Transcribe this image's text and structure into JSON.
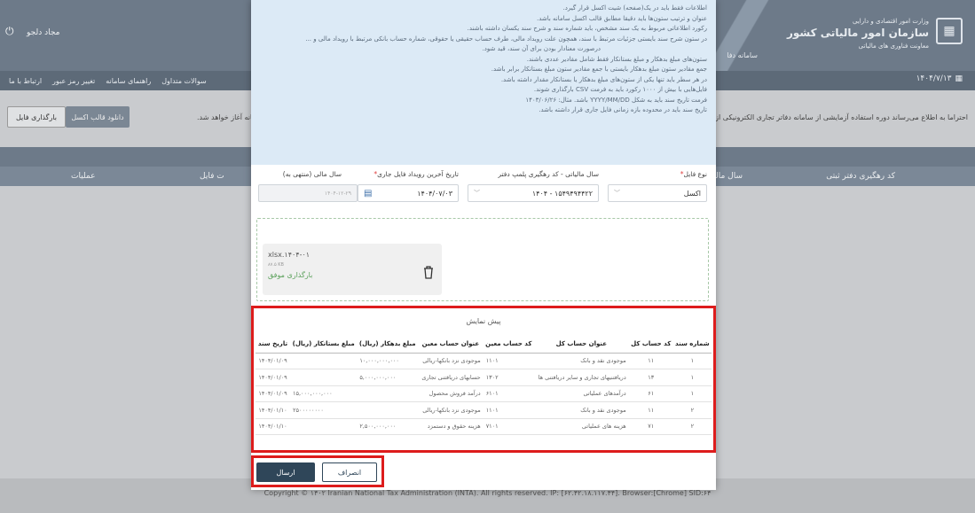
{
  "header": {
    "org_line1": "وزارت امور اقتصادی و دارایی",
    "org_line2": "سازمان امور مالیاتی کشور",
    "org_line3": "معاونت فناوری های مالیاتی",
    "system_name": "سامانه دفا",
    "user_name": "مجاد دلجو",
    "date": "۱۴۰۴/۷/۱۳"
  },
  "nav": {
    "items": [
      "سوالات متداول",
      "راهنمای سامانه",
      "تغییر رمز عبور",
      "ارتباط با ما"
    ]
  },
  "background": {
    "notice": "احتراما به اطلاع می‌رساند دوره استفاده آزمایشی از سامانه دفاتر تجاری الکترونیکی از",
    "notice_tail": "سامانه آغاز خواهد شد.",
    "upload_file_label": "بارگذاری فایل",
    "download_template_label": "دانلود قالب اکسل",
    "columns": [
      "کد رهگیری دفتر ثبتی",
      "سال مالی",
      "ت فایل",
      "عملیات"
    ],
    "footer": "Copyright © ۱۴۰۲ Iranian National Tax Administration (INTA). All rights reserved. IP: [۶۲.۴۲.۱۸.۱۱۷.۴۴]. Browser:[Chrome] SID:۶۴"
  },
  "guide": {
    "lines": [
      "اطلاعات فقط باید در یک(صفحه) شیت اکسل قرار گیرد.",
      "عنوان و ترتیب ستون‌ها باید دقیقا مطابق قالب اکسل سامانه باشد.",
      "رکورد اطلاعاتی مربوط به یک سند مشخص، باید شماره سند و شرح سند یکسان داشته باشند.",
      "در ستون شرح سند بایستی جزئیات مرتبط با سند، همچون علت رویداد مالی، طرف حساب حقیقی یا حقوقی، شماره حساب بانکی مرتبط با رویداد مالی و ...",
      "درصورت معنادار بودن برای آن سند، قید شود.",
      "ستون‌های مبلغ بدهکار و مبلغ بستانکار فقط شامل مقادیر عددی باشند.",
      "جمع مقادیر ستون مبلغ بدهکار بایستی با جمع مقادیر ستون مبلغ بستانکار برابر باشد.",
      "در هر سطر باید تنها یکی از ستون‌های مبلغ بدهکار یا بستانکار مقدار داشته باشد.",
      "فایل‌هایی با بیش از ۱۰۰۰ رکورد باید به فرمت CSV بارگذاری شوند.",
      "فرمت تاریخ سند باید به شکل YYYY/MM/DD باشد. مثال: ۱۴۰۳/۰۶/۲۶",
      "تاریخ سند باید در محدوده بازه زمانی فایل جاری قرار داشته باشد."
    ]
  },
  "form": {
    "file_type": {
      "label": "نوع فایل",
      "value": "اکسل"
    },
    "fiscal_year": {
      "label": "سال مالیاتی - کد رهگیری پلمپ دفتر",
      "value": "۱۵۴۹۴۹۴۴۲۲ - ۱۴۰۴"
    },
    "last_event_date": {
      "label": "تاریخ آخرین رویداد فایل جاری",
      "value": "۱۴۰۴/۰۷/۰۳"
    },
    "fiscal_year_end": {
      "label": "سال مالی (منتهی به)",
      "value": "۱۴۰۴-۱۲-۲۹"
    }
  },
  "upload": {
    "file_name": "xlsx.۱۴۰۴-۰۱",
    "file_size": "۸۷.۵ KB",
    "status": "بارگذاری موفق"
  },
  "preview": {
    "title": "پیش نمایش",
    "columns": [
      "شماره سند",
      "کد حساب کل",
      "عنوان حساب کل",
      "کد حساب معین",
      "عنوان حساب معین",
      "مبلغ بدهکار (ریال)",
      "مبلغ بستانکار (ریال)",
      "تاریخ سند"
    ],
    "rows": [
      [
        "۱",
        "۱۱",
        "موجودی نقد و بانک",
        "۱۱۰۱",
        "موجودی نزد بانکها-ریالی",
        "۱۰,۰۰۰,۰۰۰,۰۰۰",
        "",
        "۱۴۰۴/۰۱/۰۹"
      ],
      [
        "۱",
        "۱۳",
        "دریافتنیهای تجاری و سایر دریافتنی ها",
        "۱۳۰۲",
        "حسابهای دریافتنی تجاری",
        "۵,۰۰۰,۰۰۰,۰۰۰",
        "",
        "۱۴۰۴/۰۱/۰۹"
      ],
      [
        "۱",
        "۶۱",
        "درآمدهای عملیاتی",
        "۶۱۰۱",
        "درآمد فروش محصول",
        "",
        "۱۵,۰۰۰,۰۰۰,۰۰۰",
        "۱۴۰۴/۰۱/۰۹"
      ],
      [
        "۲",
        "۱۱",
        "موجودی نقد و بانک",
        "۱۱۰۱",
        "موجودی نزد بانکها-ریالی",
        "",
        "۲۵۰۰۰۰۰۰۰۰",
        "۱۴۰۴/۰۱/۱۰"
      ],
      [
        "۲",
        "۷۱",
        "هزینه های عملیاتی",
        "۷۱۰۱",
        "هزینه حقوق و دستمزد",
        "۲,۵۰۰,۰۰۰,۰۰۰",
        "",
        "۱۴۰۴/۰۱/۱۰"
      ]
    ]
  },
  "actions": {
    "send_label": "ارسال",
    "cancel_label": "انصراف"
  },
  "colors": {
    "highlight": "#dd1c1c",
    "primary": "#2f4659",
    "guide_bg": "#dceaf6"
  }
}
